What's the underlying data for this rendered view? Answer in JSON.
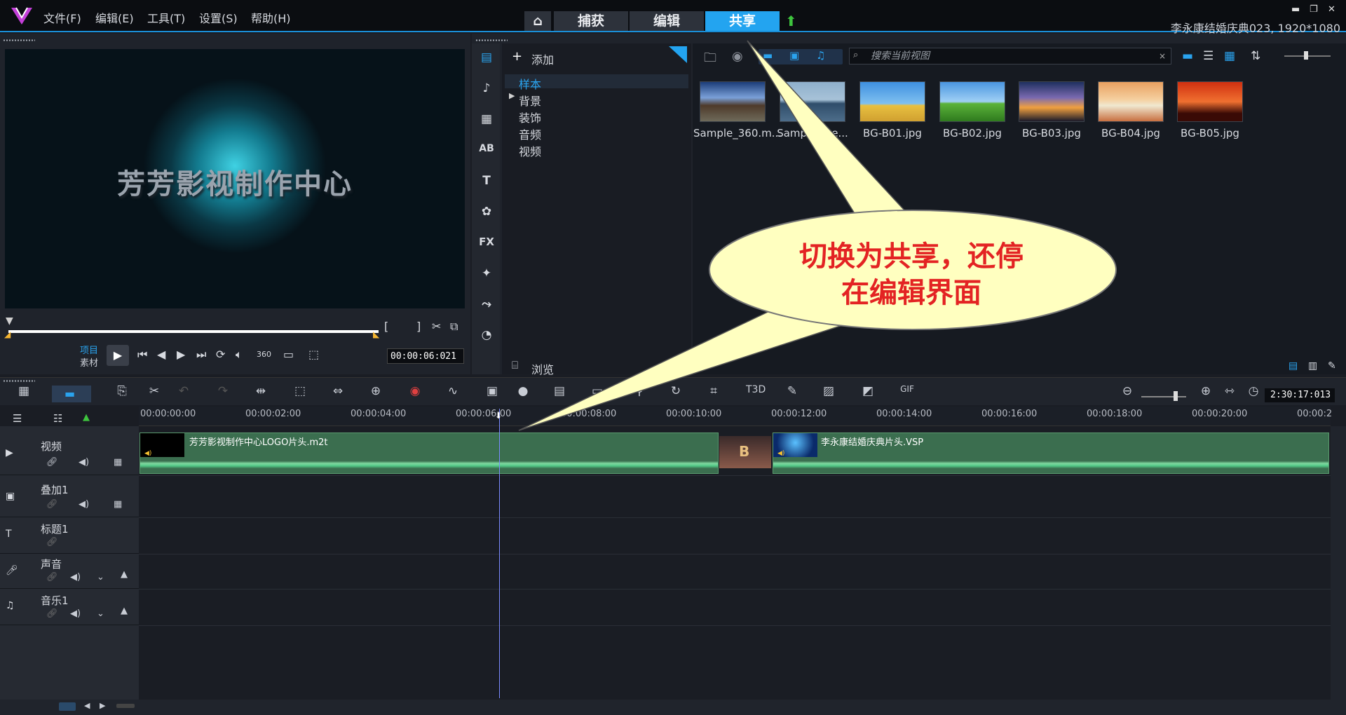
{
  "menu": {
    "file": "文件(F)",
    "edit": "编辑(E)",
    "tools": "工具(T)",
    "settings": "设置(S)",
    "help": "帮助(H)"
  },
  "tabs": {
    "capture": "捕获",
    "edit": "编辑",
    "share": "共享"
  },
  "project_info": "李永康结婚庆典023, 1920*1080",
  "preview": {
    "text": "芳芳影视制作中心",
    "project_label": "项目",
    "clip_label": "素材",
    "timecode": "00:00:06:021",
    "zoom_label": "360"
  },
  "library": {
    "add": "添加",
    "tree": [
      "样本",
      "背景",
      "装饰",
      "音频",
      "视频"
    ],
    "browse": "浏览",
    "search_placeholder": "搜索当前视图",
    "thumbs": [
      "Sample_360.m...",
      "Sample_...e...",
      "BG-B01.jpg",
      "BG-B02.jpg",
      "BG-B03.jpg",
      "BG-B04.jpg",
      "BG-B05.jpg"
    ]
  },
  "timeline": {
    "ticks": [
      "00:00:00:00",
      "00:00:02:00",
      "00:00:04:00",
      "00:00:06:00",
      "00:00:08:00",
      "00:00:10:00",
      "00:00:12:00",
      "00:00:14:00",
      "00:00:16:00",
      "00:00:18:00",
      "00:00:20:00",
      "00:00:2"
    ],
    "total_time": "2:30:17:013",
    "tracks": [
      "视频",
      "叠加1",
      "标题1",
      "声音",
      "音乐1"
    ],
    "clip1": "芳芳影视制作中心LOGO片头.m2t",
    "clip2": "李永康结婚庆典片头.VSP"
  },
  "callout": {
    "line1": "切换为共享，还停",
    "line2": "在编辑界面"
  },
  "colors": {
    "accent": "#23a4f0",
    "callout_fill": "#ffffc0",
    "callout_text": "#e32323"
  }
}
